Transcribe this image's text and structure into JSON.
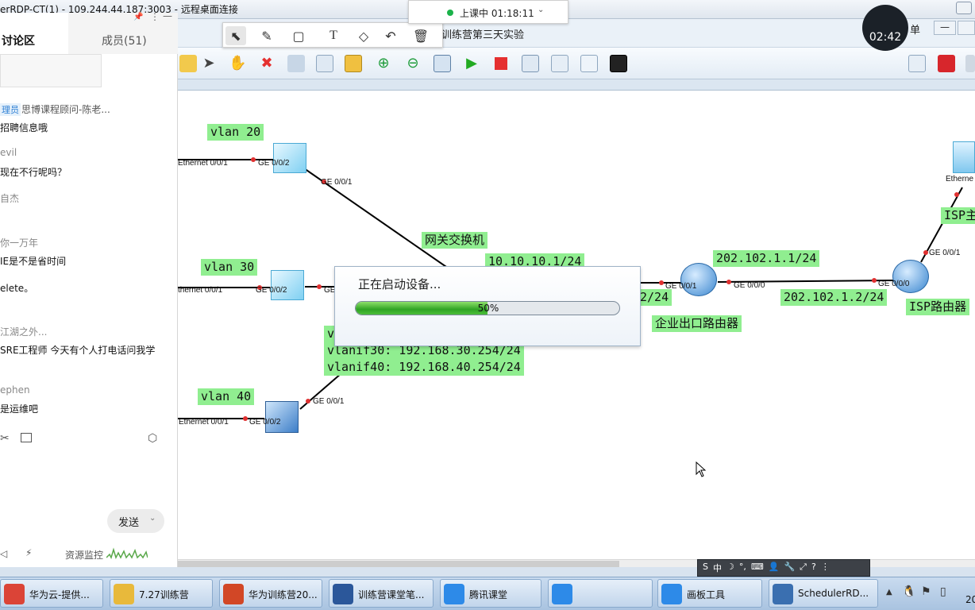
{
  "rdp": {
    "title": "erRDP-CT(1) - 109.244.44.187:3003 - 远程桌面连接"
  },
  "app": {
    "title": "训练营第三天实验",
    "menu_fragment": "单"
  },
  "class": {
    "status": "上课中 01:18:11",
    "timer": "02:42"
  },
  "chat": {
    "tab_discuss": "讨论区",
    "tab_members": "成员(51)",
    "role_badge": "理员",
    "messages": [
      {
        "name": "思博课程顾问-陈老...",
        "text": "招聘信息哦"
      },
      {
        "name": "evil",
        "text": "现在不行呢吗？"
      },
      {
        "name": "自杰",
        "text": ""
      },
      {
        "name": "你一万年",
        "text": "IE是不是省时间"
      },
      {
        "name": "",
        "text": "elete。"
      },
      {
        "name": "江湖之外...",
        "text": "SRE工程师  今天有个人打电话问我学"
      },
      {
        "name": "ephen",
        "text": "是运维吧"
      }
    ],
    "send_label": "发送",
    "resource_label": "资源监控"
  },
  "topology": {
    "labels": {
      "vlan20": "vlan 20",
      "vlan30": "vlan 30",
      "vlan40": "vlan 40",
      "gateway_switch": "网关交换机",
      "ip_gateway": "10.10.10.1/24",
      "ip_edge_suffix": "2/24",
      "ip_wan1": "202.102.1.1/24",
      "ip_wan2": "202.102.1.2/24",
      "edge_router": "企业出口路由器",
      "isp_router": "ISP路由器",
      "isp_host": "ISP主",
      "vlanif_partial": "v",
      "vlanif30": "vlanif30: 192.168.30.254/24",
      "vlanif40": "vlanif40: 192.168.40.254/24"
    },
    "ports": {
      "sw20_eth": "Ethernet 0/0/1",
      "sw20_ge2": "GE 0/0/2",
      "sw20_ge1": "GE 0/0/1",
      "sw30_eth": "thernet 0/0/1",
      "sw30_ge2": "GE 0/0/2",
      "sw30_ge": "GE",
      "sw40_eth": "Ethernet 0/0/1",
      "sw40_ge2": "GE 0/0/2",
      "sw40_ge1": "GE 0/0/1",
      "r1_ge1": "GE 0/0/1",
      "r1_ge0": "GE 0/0/0",
      "r2_ge0": "GE 0/0/0",
      "r2_ge1": "GE 0/0/1",
      "isp_eth": "Etherne"
    },
    "colors": {
      "label_bg": "#90ee90",
      "link": "#000000",
      "port_dot": "#e03030"
    }
  },
  "progress": {
    "title": "正在启动设备...",
    "percent": 50,
    "percent_text": "50%"
  },
  "taskbar": {
    "items": [
      {
        "label": "华为云-提供...",
        "color": "#db4437"
      },
      {
        "label": "7.27训练营",
        "color": "#e8b93b"
      },
      {
        "label": "华为训练营20...",
        "color": "#d24726"
      },
      {
        "label": "训练营课堂笔...",
        "color": "#2b579a"
      },
      {
        "label": "腾讯课堂",
        "color": "#2d8ae8"
      },
      {
        "label": "",
        "color": "#2d8ae8"
      },
      {
        "label": "画板工具",
        "color": "#2d8ae8"
      },
      {
        "label": "SchedulerRD...",
        "color": "#3a6fb0"
      }
    ],
    "clock_fragment": "20"
  },
  "ime": {
    "items": [
      "S",
      "中",
      "☽",
      "°,",
      "⌨",
      "👤",
      "🔧",
      "⤢",
      "?",
      "⋮"
    ]
  }
}
